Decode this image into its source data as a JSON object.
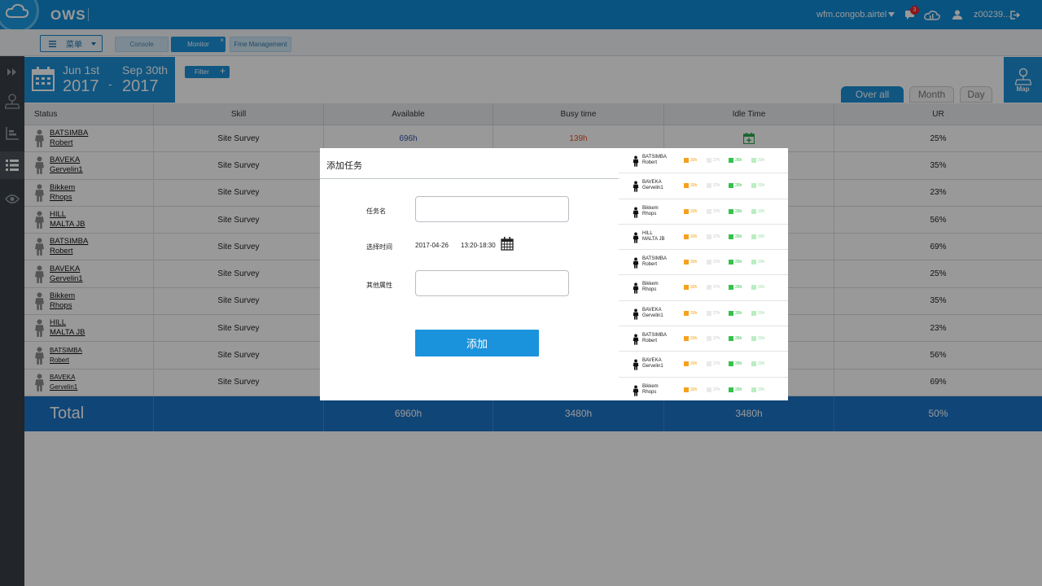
{
  "header": {
    "app_title": "OWS",
    "account": "wfm.congob.airtel",
    "notification_count": "3",
    "username": "z00239..."
  },
  "toolbar": {
    "menu_label": "菜单",
    "tabs": [
      {
        "label": "Console"
      },
      {
        "label": "Monitor",
        "close": "×"
      },
      {
        "label": "Fme Management"
      }
    ]
  },
  "daterange": {
    "start_label": "Jun 1st",
    "start_year": "2017",
    "dash": "-",
    "end_label": "Sep 30th",
    "end_year": "2017"
  },
  "filter": {
    "label": "Filter",
    "plus": "+"
  },
  "views": {
    "overall": "Over all",
    "month": "Month",
    "day": "Day"
  },
  "map": {
    "label": "Map"
  },
  "table": {
    "headers": [
      "Status",
      "Skill",
      "Available",
      "Busy time",
      "Idle Time",
      "UR"
    ],
    "rows": [
      {
        "name1": "BATSIMBA",
        "name2": "Robert",
        "skill": "Site Survey",
        "available": "696h",
        "busy": "139h",
        "ur": "25%",
        "small": false
      },
      {
        "name1": "BAVEKA",
        "name2": "Gervelin1",
        "skill": "Site Survey",
        "ur": "35%",
        "small": false
      },
      {
        "name1": "Bikkem",
        "name2": "Rhops",
        "skill": "Site Survey",
        "ur": "23%",
        "small": false
      },
      {
        "name1": "HILL",
        "name2": "MALTA JB",
        "skill": "Site Survey",
        "ur": "56%",
        "small": false
      },
      {
        "name1": "BATSIMBA",
        "name2": "Robert",
        "skill": "Site Survey",
        "ur": "69%",
        "small": false
      },
      {
        "name1": "BAVEKA",
        "name2": "Gervelin1",
        "skill": "Site Survey",
        "ur": "25%",
        "small": false
      },
      {
        "name1": "Bikkem",
        "name2": "Rhops",
        "skill": "Site Survey",
        "ur": "35%",
        "small": false
      },
      {
        "name1": "HILL",
        "name2": "MALTA JB",
        "skill": "Site Survey",
        "ur": "23%",
        "small": false
      },
      {
        "name1": "BATSIMBA",
        "name2": "Robert",
        "skill": "Site Survey",
        "ur": "56%",
        "small": true
      },
      {
        "name1": "BAVEKA",
        "name2": "Gervelin1",
        "skill": "Site Survey",
        "ur": "69%",
        "small": true
      }
    ],
    "total": {
      "label": "Total",
      "available": "6960h",
      "busy": "3480h",
      "idle": "3480h",
      "ur": "50%"
    }
  },
  "modal": {
    "title": "添加任务",
    "task_name_label": "任务名",
    "time_label": "选择时间",
    "date_value": "2017-04-26",
    "time_value": "13:20-18:30",
    "other_label": "其他属性",
    "add_button": "添加",
    "side_list": [
      {
        "name1": "BATSIMBA",
        "name2": "Robert"
      },
      {
        "name1": "BAVEKA",
        "name2": "Gervelin1"
      },
      {
        "name1": "Bikkem",
        "name2": "Rhops"
      },
      {
        "name1": "HILL",
        "name2": "MALTA JB"
      },
      {
        "name1": "BATSIMBA",
        "name2": "Robert"
      },
      {
        "name1": "Bikkem",
        "name2": "Rhops"
      },
      {
        "name1": "BAVEKA",
        "name2": "Gervelin1"
      },
      {
        "name1": "BATSIMBA",
        "name2": "Robert"
      },
      {
        "name1": "BAVEKA",
        "name2": "Gervelin1"
      },
      {
        "name1": "Bikkem",
        "name2": "Rhops"
      }
    ],
    "side_values": [
      "30h",
      "37h",
      "26h",
      "30h"
    ],
    "side_colors": [
      "#f5a11f",
      "#e9e9e9",
      "#35c24d",
      "#b9eec2"
    ]
  },
  "colors": {
    "primary": "#1b8fd8",
    "header": "#0f8bd6",
    "total": "#1b74c6",
    "busy": "#e0562a",
    "available": "#3353a8"
  }
}
